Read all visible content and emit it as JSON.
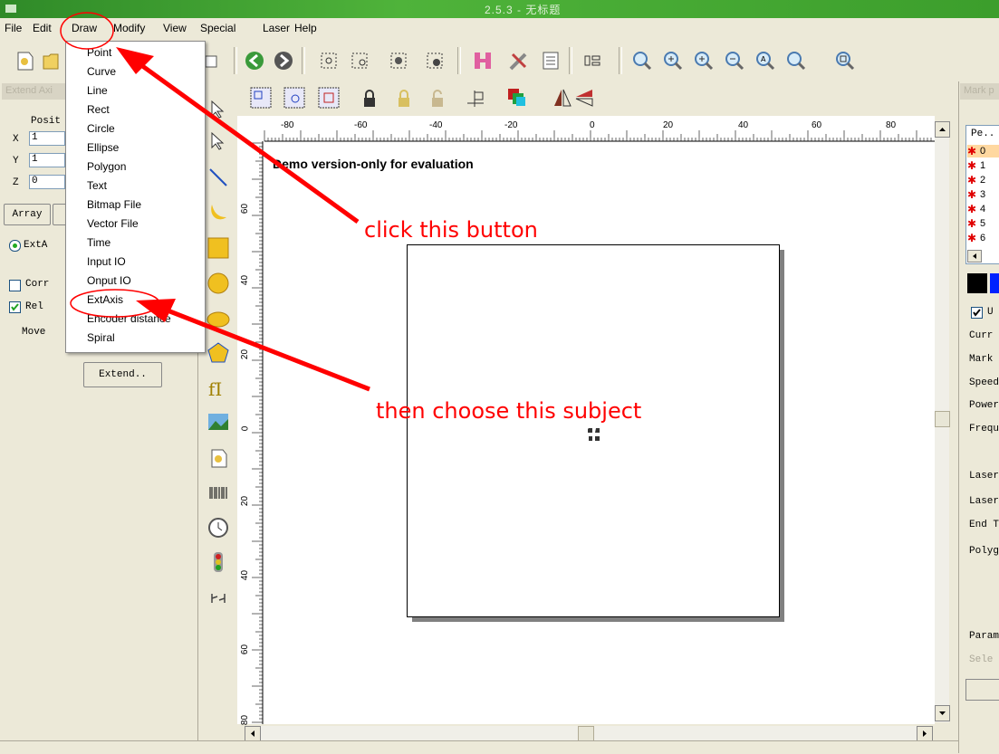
{
  "window": {
    "title": "2.5.3 - 无标题"
  },
  "menu": [
    "File",
    "Edit",
    "Draw",
    "Modify",
    "View",
    "Special",
    "Laser",
    "Help"
  ],
  "draw_menu": [
    "Point",
    "Curve",
    "Line",
    "Rect",
    "Circle",
    "Ellipse",
    "Polygon",
    "Text",
    "Bitmap File",
    "Vector File",
    "Time",
    "Input IO",
    "Onput IO",
    "ExtAxis",
    "Encoder distance",
    "Spiral"
  ],
  "left_panel": {
    "title": "Extend Axi",
    "position_label": "Posit",
    "x_label": "X",
    "x_value": "1",
    "y_label": "Y",
    "y_value": "1",
    "z_label": "Z",
    "z_value": "0",
    "array_button": "Array",
    "ext_radio": "ExtA",
    "corr_check": "Corr",
    "rel_check": "Rel",
    "move_label": "Move",
    "extend_button": "Extend.."
  },
  "canvas": {
    "demo_text": "Demo version-only for evaluation",
    "h_ruler": [
      "-80",
      "-60",
      "-40",
      "-20",
      "0",
      "20",
      "40",
      "60",
      "80"
    ],
    "v_ruler": [
      "60",
      "40",
      "20",
      "0",
      "20",
      "40",
      "60",
      "80"
    ]
  },
  "right_panel": {
    "title": "Mark p",
    "pen_header": "Pe..",
    "pens": [
      "0",
      "1",
      "2",
      "3",
      "4",
      "5",
      "6"
    ],
    "use_check": "U",
    "labels": [
      "Curr",
      "Mark",
      "Speed",
      "Power",
      "Frequ",
      "Laser",
      "Laser",
      "End T",
      "Polyg"
    ],
    "param": "Param",
    "select": "Sele"
  },
  "annotations": {
    "click": "click this button",
    "choose": "then choose this subject"
  },
  "colors": {
    "annotation": "#ff0000",
    "titlebar": "#3c9e2c"
  }
}
